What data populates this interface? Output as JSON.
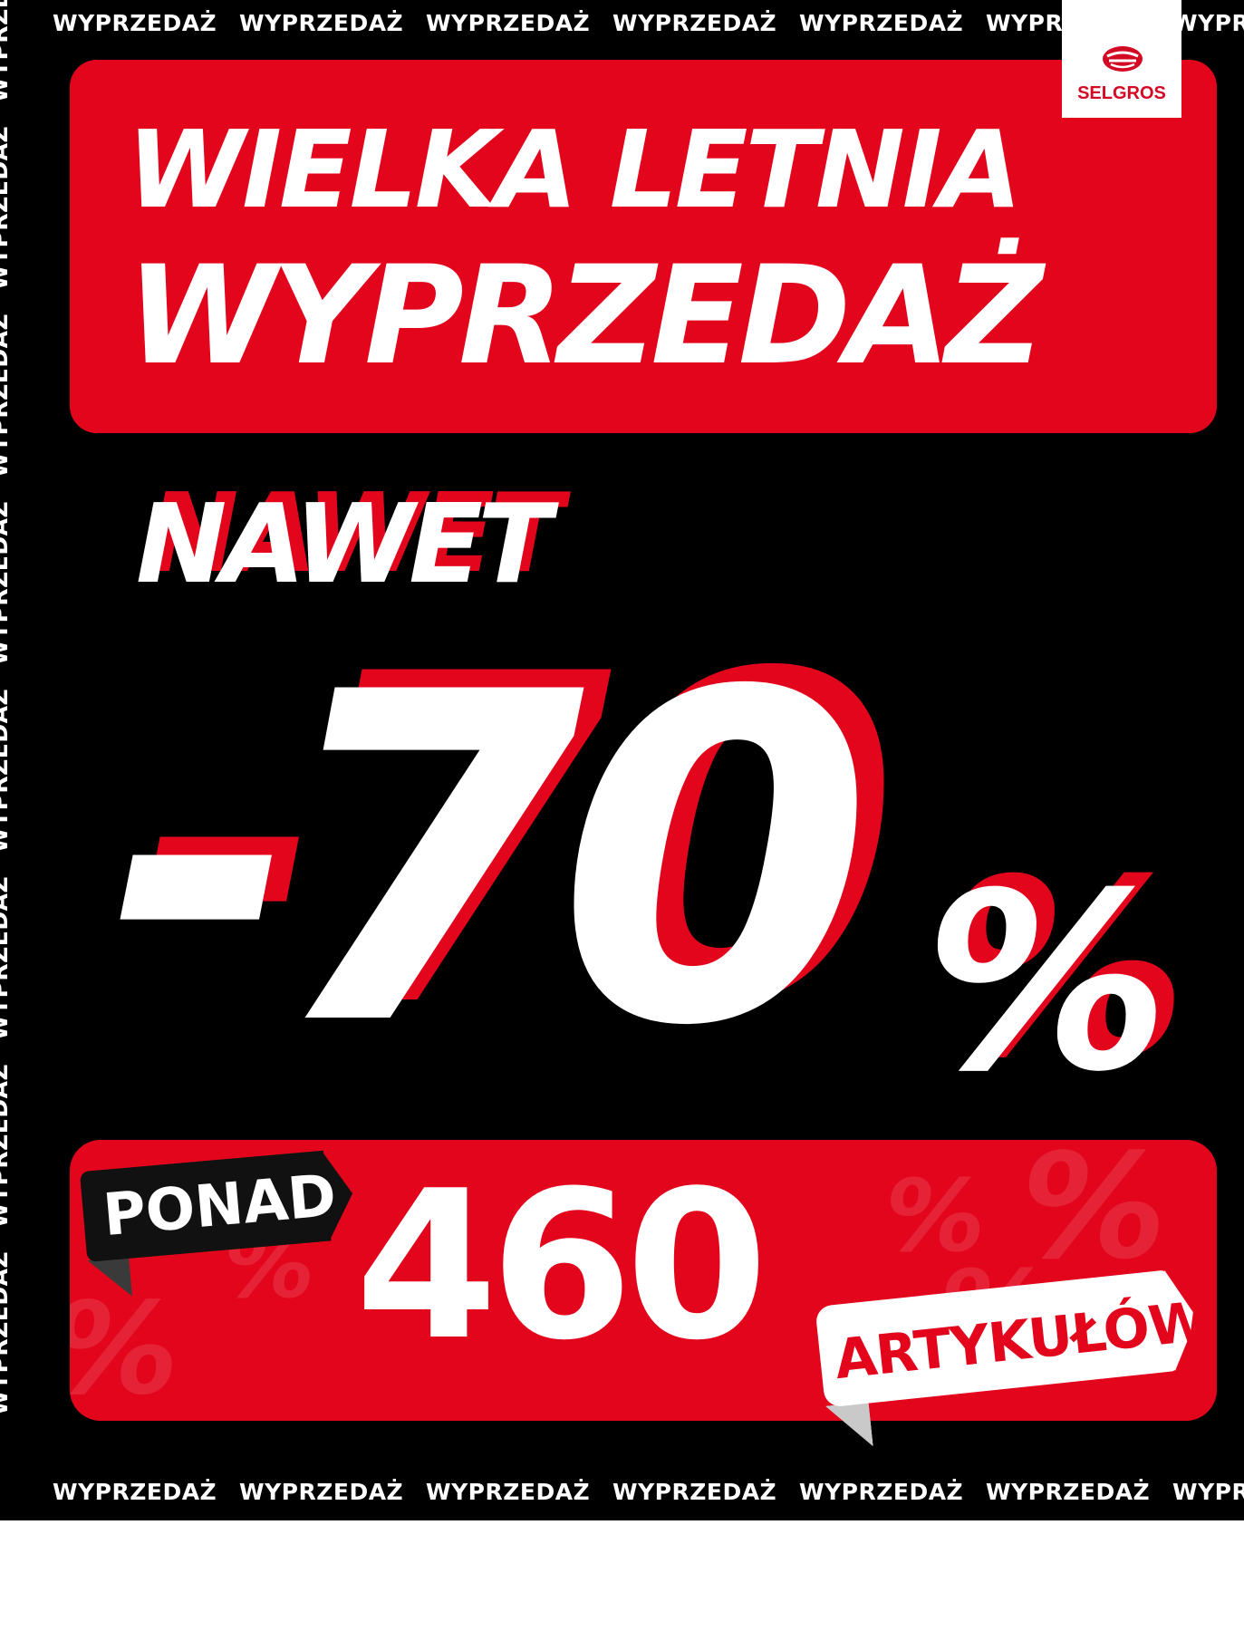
{
  "strip": {
    "top": [
      "WYPRZEDAŻ",
      "WYPRZEDAŻ",
      "WYPRZEDAŻ",
      "WYPRZEDAŻ",
      "WYPRZEDAŻ",
      "WYPRZEDAŻ",
      "WYPRZEDAŻ"
    ],
    "bottom": [
      "WYPRZEDAŻ",
      "WYPRZEDAŻ",
      "WYPRZEDAŻ",
      "WYPRZEDAŻ",
      "WYPRZEDAŻ",
      "WYPRZEDAŻ",
      "WYPRZEDAŻ"
    ],
    "left": [
      "WYPRZEDAŻ",
      "WYPRZEDAŻ",
      "WYPRZEDAŻ",
      "WYPRZEDAŻ",
      "WYPRZEDAŻ",
      "WYPRZEDAŻ",
      "WYPRZEDAŻ",
      "WYPRZEDAŻ"
    ]
  },
  "logo": {
    "brand": "SELGROS",
    "icon": "selgros-fork-logo-icon"
  },
  "headline": {
    "line1": "WIELKA LETNIA",
    "line2": "WYPRZEDAŻ"
  },
  "offer": {
    "prefix": "NAWET",
    "discount": "-70",
    "percent": "%"
  },
  "count": {
    "label_before": "PONAD",
    "value": "460",
    "label_after": "ARTYKUŁÓW"
  },
  "colors": {
    "accent": "#e3051b",
    "background": "#000000",
    "text": "#ffffff"
  }
}
